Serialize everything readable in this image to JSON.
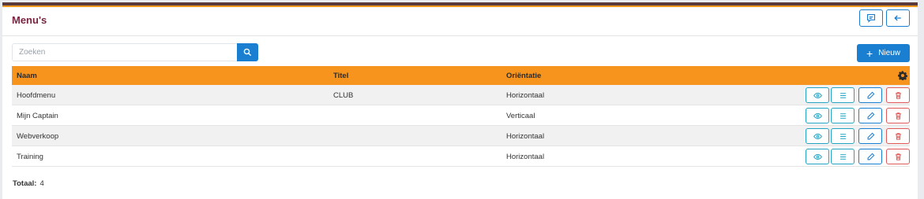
{
  "page": {
    "title": "Menu's"
  },
  "header": {
    "feedback_icon": "comment-icon",
    "back_icon": "arrow-left-icon"
  },
  "search": {
    "placeholder": "Zoeken",
    "value": "",
    "icon": "search-icon"
  },
  "toolbar": {
    "new_label": "Nieuw",
    "new_icon": "plus-icon"
  },
  "colors": {
    "accent": "#1a7fd0",
    "header_row": "#f7941d",
    "title": "#7a2540",
    "info": "#22a3c3",
    "danger": "#e05a5a"
  },
  "table": {
    "columns": [
      "Naam",
      "Titel",
      "Oriëntatie"
    ],
    "settings_icon": "gear-icon",
    "rows": [
      {
        "naam": "Hoofdmenu",
        "titel": "CLUB",
        "orientatie": "Horizontaal"
      },
      {
        "naam": "Mijn Captain",
        "titel": "",
        "orientatie": "Verticaal"
      },
      {
        "naam": "Webverkoop",
        "titel": "",
        "orientatie": "Horizontaal"
      },
      {
        "naam": "Training",
        "titel": "",
        "orientatie": "Horizontaal"
      }
    ],
    "row_actions": [
      "eye-icon",
      "list-icon",
      "pencil-icon",
      "trash-icon"
    ]
  },
  "footer": {
    "total_label": "Totaal:",
    "total_value": "4"
  }
}
